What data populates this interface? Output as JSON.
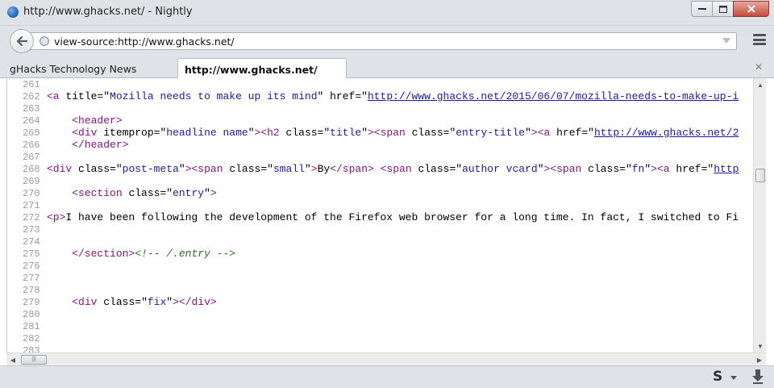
{
  "window": {
    "title": "http://www.ghacks.net/ - Nightly"
  },
  "navbar": {
    "url": "view-source:http://www.ghacks.net/"
  },
  "tabs": [
    {
      "label": "gHacks Technology News",
      "active": false
    },
    {
      "label": "http://www.ghacks.net/",
      "active": true
    }
  ],
  "source_lines": [
    {
      "num": "261",
      "html": ""
    },
    {
      "num": "262",
      "html": "<span class=\"t\">&lt;a</span> <span class=\"a\">title=</span>\"<span class=\"v\">Mozilla needs to make up its mind</span>\" <span class=\"a\">href=</span>\"<span class=\"lnk\">http://www.ghacks.net/2015/06/07/mozilla-needs-to-make-up-i</span>"
    },
    {
      "num": "263",
      "html": ""
    },
    {
      "num": "264",
      "html": "    <span class=\"t\">&lt;header&gt;</span>"
    },
    {
      "num": "265",
      "html": "    <span class=\"t\">&lt;div</span> <span class=\"a\">itemprop=</span>\"<span class=\"v\">headline name</span>\"<span class=\"t\">&gt;&lt;h2</span> <span class=\"a\">class=</span>\"<span class=\"v\">title</span>\"<span class=\"t\">&gt;&lt;span</span> <span class=\"a\">class=</span>\"<span class=\"v\">entry-title</span>\"<span class=\"t\">&gt;&lt;a</span> <span class=\"a\">href=</span>\"<span class=\"lnk\">http://www.ghacks.net/2</span>"
    },
    {
      "num": "266",
      "html": "    <span class=\"t\">&lt;/header&gt;</span>"
    },
    {
      "num": "267",
      "html": ""
    },
    {
      "num": "268",
      "html": "<span class=\"t\">&lt;div</span> <span class=\"a\">class=</span>\"<span class=\"v\">post-meta</span>\"<span class=\"t\">&gt;&lt;span</span> <span class=\"a\">class=</span>\"<span class=\"v\">small</span>\"<span class=\"t\">&gt;</span>By<span class=\"t\">&lt;/span&gt;</span> <span class=\"t\">&lt;span</span> <span class=\"a\">class=</span>\"<span class=\"v\">author vcard</span>\"<span class=\"t\">&gt;&lt;span</span> <span class=\"a\">class=</span>\"<span class=\"v\">fn</span>\"<span class=\"t\">&gt;&lt;a</span> <span class=\"a\">href=</span>\"<span class=\"lnk\">http</span>"
    },
    {
      "num": "269",
      "html": ""
    },
    {
      "num": "270",
      "html": "    <span class=\"t\">&lt;section</span> <span class=\"a\">class=</span>\"<span class=\"v\">entry</span>\"<span class=\"t\">&gt;</span>"
    },
    {
      "num": "271",
      "html": ""
    },
    {
      "num": "272",
      "html": "<span class=\"t\">&lt;p&gt;</span>I have been following the development of the Firefox web browser for a long time. In fact, I switched to Fi"
    },
    {
      "num": "273",
      "html": ""
    },
    {
      "num": "274",
      "html": ""
    },
    {
      "num": "275",
      "html": "    <span class=\"t\">&lt;/section&gt;</span><span class=\"c\">&lt;!-- /.entry --&gt;</span>"
    },
    {
      "num": "276",
      "html": ""
    },
    {
      "num": "277",
      "html": ""
    },
    {
      "num": "278",
      "html": ""
    },
    {
      "num": "279",
      "html": "    <span class=\"t\">&lt;div</span> <span class=\"a\">class=</span>\"<span class=\"v\">fix</span>\"<span class=\"t\">&gt;&lt;/div&gt;</span>"
    },
    {
      "num": "280",
      "html": ""
    },
    {
      "num": "281",
      "html": ""
    },
    {
      "num": "282",
      "html": ""
    },
    {
      "num": "283",
      "html": ""
    }
  ],
  "addonbar": {
    "s_label": "S"
  }
}
